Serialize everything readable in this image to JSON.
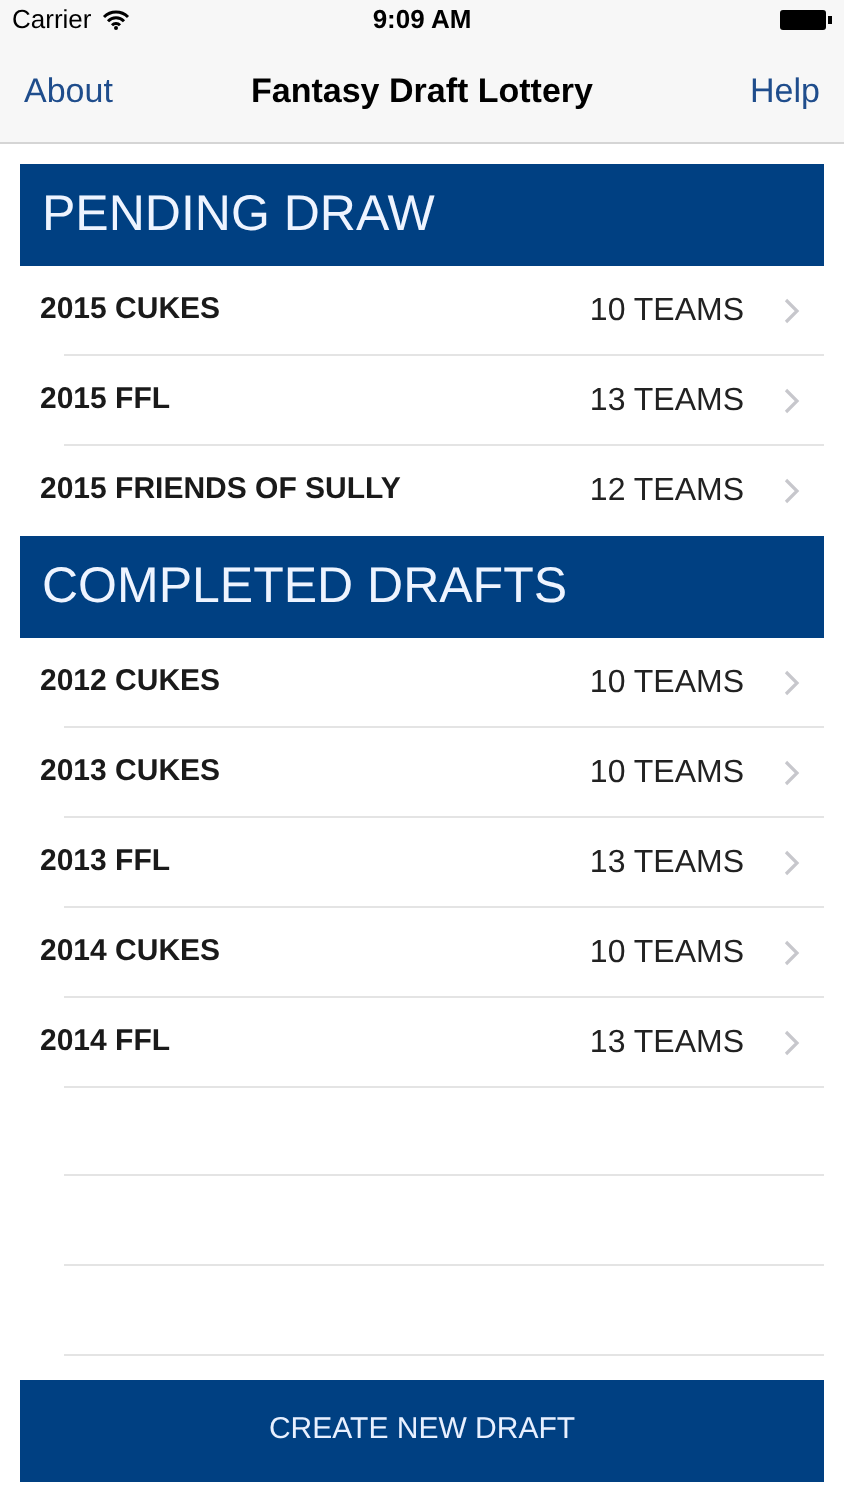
{
  "status_bar": {
    "carrier": "Carrier",
    "time": "9:09 AM"
  },
  "nav_bar": {
    "left": "About",
    "title": "Fantasy Draft Lottery",
    "right": "Help"
  },
  "sections": [
    {
      "title": "PENDING DRAW",
      "rows": [
        {
          "name": "2015 CUKES",
          "teams": "10 TEAMS"
        },
        {
          "name": "2015 FFL",
          "teams": "13 TEAMS"
        },
        {
          "name": "2015 FRIENDS OF SULLY",
          "teams": "12 TEAMS"
        }
      ]
    },
    {
      "title": "COMPLETED DRAFTS",
      "rows": [
        {
          "name": "2012 CUKES",
          "teams": "10 TEAMS"
        },
        {
          "name": "2013 CUKES",
          "teams": "10 TEAMS"
        },
        {
          "name": "2013 FFL",
          "teams": "13 TEAMS"
        },
        {
          "name": "2014 CUKES",
          "teams": "10 TEAMS"
        },
        {
          "name": "2014 FFL",
          "teams": "13 TEAMS"
        }
      ]
    }
  ],
  "button": "CREATE NEW DRAFT"
}
